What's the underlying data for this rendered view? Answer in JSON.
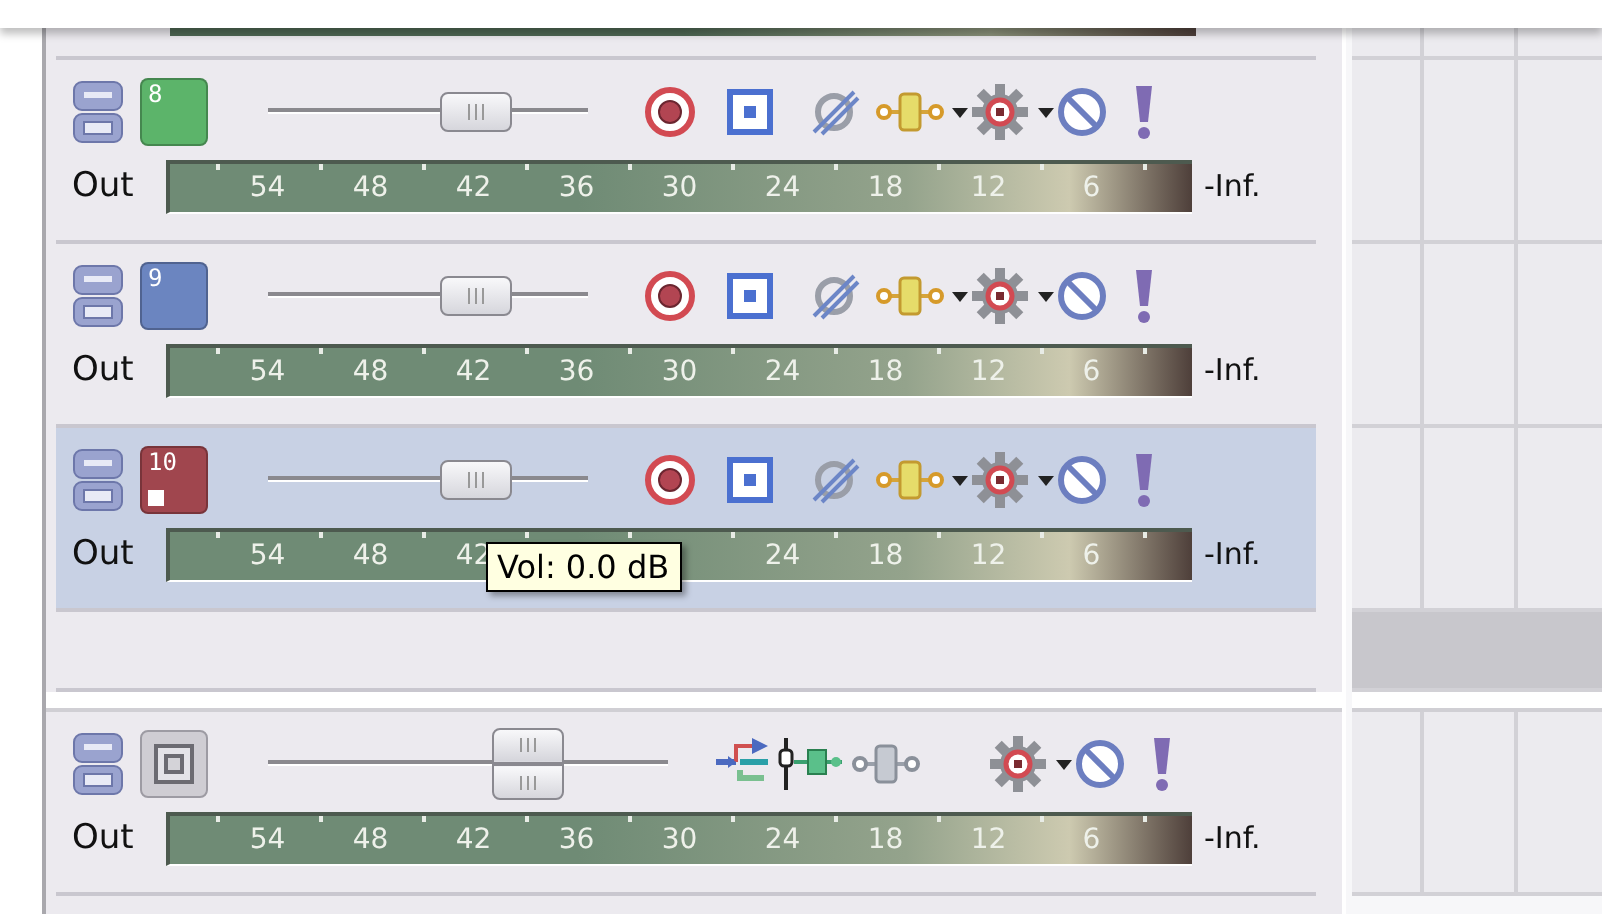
{
  "tracks": [
    {
      "number": "8",
      "color": "#5cb46a",
      "selected": false,
      "armed": false,
      "volume": {
        "level": 0.69
      },
      "meter": {
        "label": "Out",
        "end_label": "-Inf.",
        "scale": [
          {
            "kind": "label",
            "text": "54"
          },
          {
            "kind": "label",
            "text": "48"
          },
          {
            "kind": "label",
            "text": "42"
          },
          {
            "kind": "label",
            "text": "36"
          },
          {
            "kind": "label",
            "text": "30"
          },
          {
            "kind": "label",
            "text": "24"
          },
          {
            "kind": "label",
            "text": "18"
          },
          {
            "kind": "label",
            "text": "12"
          },
          {
            "kind": "label",
            "text": "6"
          }
        ]
      }
    },
    {
      "number": "9",
      "color": "#6b85c0",
      "selected": false,
      "armed": false,
      "volume": {
        "level": 0.69
      },
      "meter": {
        "label": "Out",
        "end_label": "-Inf.",
        "scale": [
          {
            "kind": "label",
            "text": "54"
          },
          {
            "kind": "label",
            "text": "48"
          },
          {
            "kind": "label",
            "text": "42"
          },
          {
            "kind": "label",
            "text": "36"
          },
          {
            "kind": "label",
            "text": "30"
          },
          {
            "kind": "label",
            "text": "24"
          },
          {
            "kind": "label",
            "text": "18"
          },
          {
            "kind": "label",
            "text": "12"
          },
          {
            "kind": "label",
            "text": "6"
          }
        ]
      }
    },
    {
      "number": "10",
      "color": "#a0464e",
      "selected": true,
      "armed": true,
      "volume": {
        "level": 0.69
      },
      "meter": {
        "label": "Out",
        "end_label": "-Inf.",
        "scale": [
          {
            "kind": "label",
            "text": "54"
          },
          {
            "kind": "label",
            "text": "48"
          },
          {
            "kind": "label",
            "text": "42"
          },
          {
            "kind": "tooltip",
            "text": "Vol: 0.0 dB"
          },
          {
            "kind": "label",
            "text": "24"
          },
          {
            "kind": "label",
            "text": "18"
          },
          {
            "kind": "label",
            "text": "12"
          },
          {
            "kind": "label",
            "text": "6"
          }
        ]
      }
    }
  ],
  "master": {
    "volume": {
      "level": 0.68
    },
    "meter": {
      "label": "Out",
      "end_label": "-Inf.",
      "scale": [
        {
          "kind": "label",
          "text": "54"
        },
        {
          "kind": "label",
          "text": "48"
        },
        {
          "kind": "label",
          "text": "42"
        },
        {
          "kind": "label",
          "text": "36"
        },
        {
          "kind": "label",
          "text": "30"
        },
        {
          "kind": "label",
          "text": "24"
        },
        {
          "kind": "label",
          "text": "18"
        },
        {
          "kind": "label",
          "text": "12"
        },
        {
          "kind": "label",
          "text": "6"
        }
      ]
    }
  }
}
